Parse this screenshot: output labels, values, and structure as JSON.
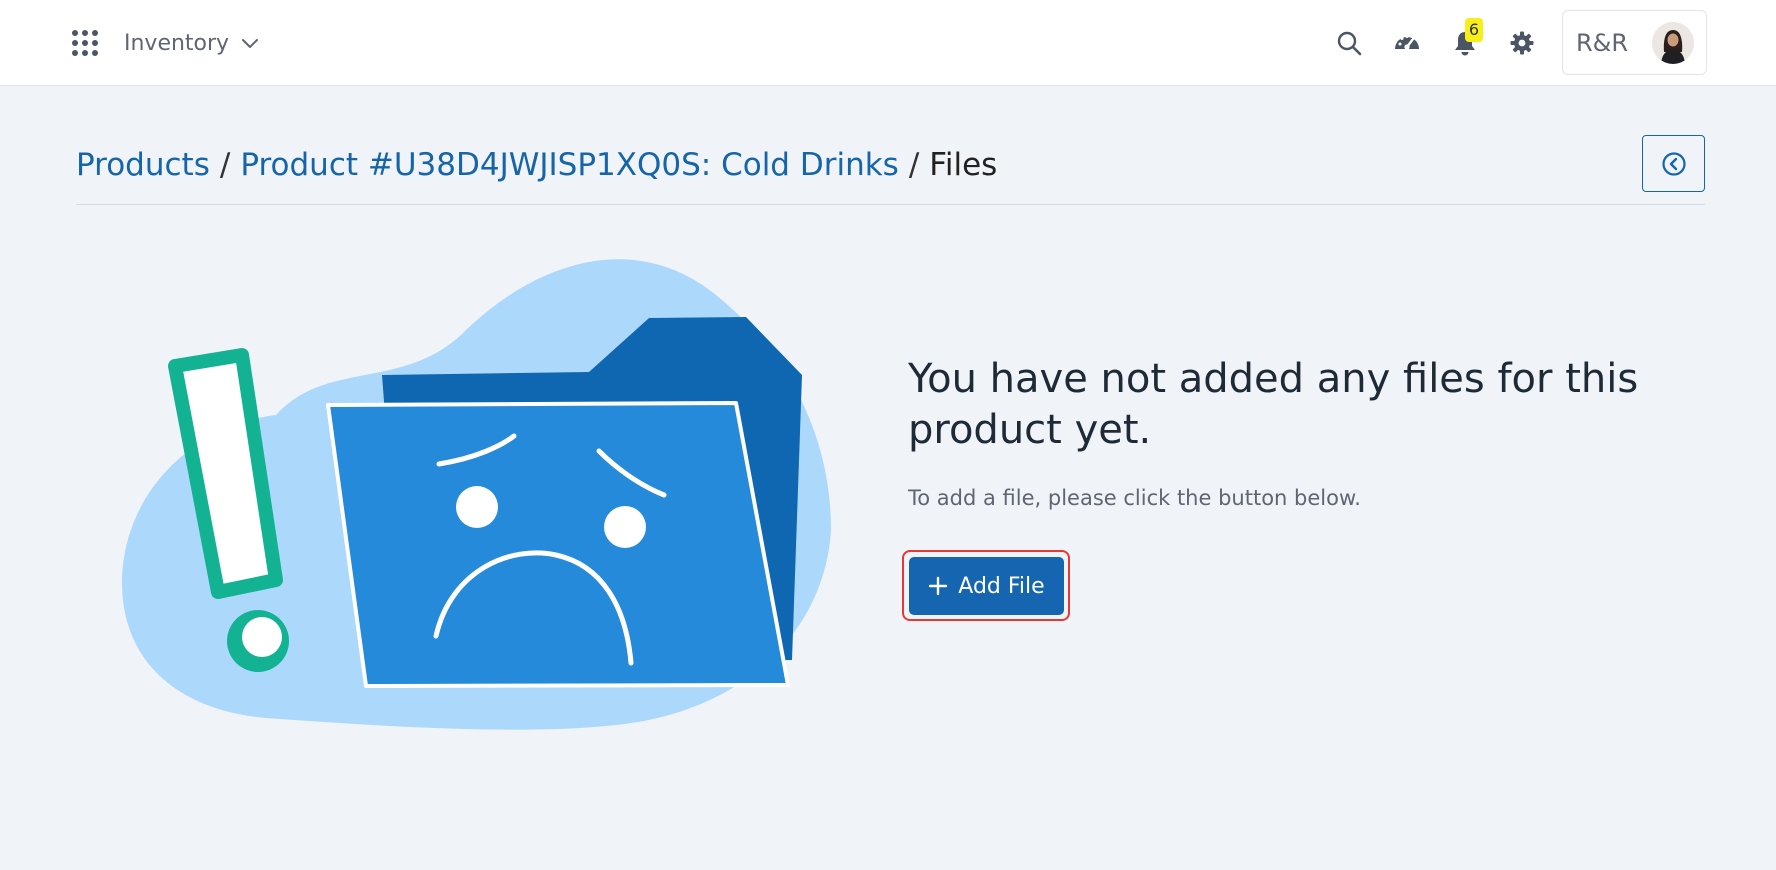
{
  "header": {
    "module_name": "Inventory",
    "notification_count": "6",
    "user_initials": "R&R"
  },
  "breadcrumb": {
    "items": [
      "Products",
      "Product #U38D4JWJISP1XQ0S: Cold Drinks"
    ],
    "separator": "/",
    "current": "Files"
  },
  "empty_state": {
    "title": "You have not added any files for this product yet.",
    "subtitle": "To add a file, please click the button below.",
    "add_button_label": "Add File"
  },
  "colors": {
    "accent": "#1565b0",
    "link": "#1565a8",
    "highlight_outline": "#e53935",
    "badge": "#f7ee1a",
    "illustration_blob": "#acd8fb",
    "folder_back": "#0f67b1",
    "folder_front": "#258ad9",
    "exclamation": "#12b293"
  },
  "icons": {
    "apps": "apps-grid-icon",
    "search": "search-icon",
    "dashboard": "speedometer-icon",
    "notifications": "bell-icon",
    "settings": "gear-icon",
    "back": "circle-chevron-left-icon",
    "add": "plus-icon"
  }
}
